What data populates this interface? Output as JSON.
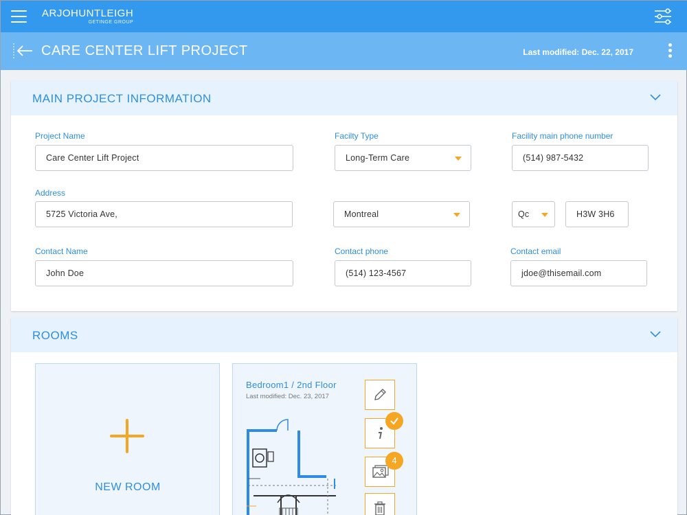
{
  "header": {
    "brand_name": "ARJOHUNTLEIGH",
    "brand_sub": "GETINGE GROUP"
  },
  "titlebar": {
    "title": "CARE CENTER LIFT PROJECT",
    "last_modified": "Last modified: Dec. 22, 2017"
  },
  "main_info": {
    "section_title": "MAIN PROJECT INFORMATION",
    "project_name_label": "Project Name",
    "project_name_value": "Care Center Lift Project",
    "facility_type_label": "Facilty Type",
    "facility_type_value": "Long-Term Care",
    "facility_phone_label": "Facility main phone number",
    "facility_phone_value": "(514) 987-5432",
    "address_label": "Address",
    "address_value": "5725 Victoria Ave,",
    "city_value": "Montreal",
    "province_value": "Qc",
    "postal_value": "H3W 3H6",
    "contact_name_label": "Contact Name",
    "contact_name_value": "John Doe",
    "contact_phone_label": "Contact phone",
    "contact_phone_value": "(514) 123-4567",
    "contact_email_label": "Contact email",
    "contact_email_value": "jdoe@thisemail.com"
  },
  "rooms": {
    "section_title": "ROOMS",
    "new_room_label": "NEW ROOM",
    "items": [
      {
        "name": "Bedroom1 / 2nd Floor",
        "last_modified": "Last modified: Dec. 23, 2017",
        "photo_count": "4"
      }
    ]
  },
  "colors": {
    "header_blue": "#3399ee",
    "title_blue": "#6cb6f4",
    "accent_orange": "#f5a623",
    "text_blue": "#2e8ee0"
  },
  "icons": [
    "hamburger-menu-icon",
    "filter-settings-icon",
    "back-arrow-icon",
    "more-vertical-icon",
    "chevron-down-icon",
    "plus-icon",
    "pencil-icon",
    "info-icon",
    "check-icon",
    "image-icon",
    "trash-icon"
  ]
}
